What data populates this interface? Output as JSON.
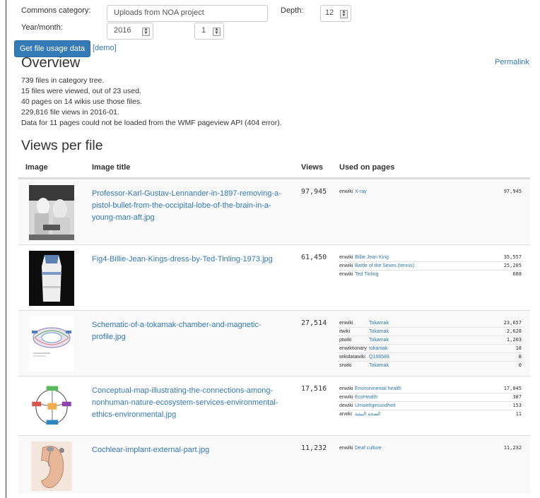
{
  "form": {
    "category_label": "Commons category:",
    "category_value": "Uploads from NOA project",
    "depth_label": "Depth:",
    "depth_value": "12",
    "yearmonth_label": "Year/month:",
    "year_value": "2016",
    "month_value": "1",
    "submit_label": "Get file usage data",
    "demo_label": "[demo]"
  },
  "overview": {
    "heading": "Overview",
    "permalink": "Permalink",
    "lines": [
      "739 files in category tree.",
      "15 files were viewed, out of 23 used.",
      "40 pages on 14 wikis use those files.",
      "229,816 file views in 2016-01.",
      "Data for 11 pages could not be loaded from the WMF pageview API (404 error)."
    ]
  },
  "views_per_file": {
    "heading": "Views per file",
    "columns": [
      "Image",
      "Image title",
      "Views",
      "Used on pages"
    ],
    "rows": [
      {
        "title": "Professor-Karl-Gustav-Lennander-in-1897-removing-a-pistol-bullet-from-the-occipital-lobe-of-the-brain-in-a-young-man-aft.jpg",
        "views": "97,945",
        "uses": [
          {
            "wiki": "enwiki",
            "page": "X-ray",
            "count": "97,945"
          }
        ]
      },
      {
        "title": "Fig4-Billie-Jean-Kings-dress-by-Ted-Tinling-1973.jpg",
        "views": "61,450",
        "uses": [
          {
            "wiki": "enwiki",
            "page": "Billie Jean King",
            "count": "35,557"
          },
          {
            "wiki": "enwiki",
            "page": "Battle of the Sexes (tennis)",
            "count": "25,205"
          },
          {
            "wiki": "enwiki",
            "page": "Ted Tinling",
            "count": "688"
          }
        ]
      },
      {
        "title": "Schematic-of-a-tokamak-chamber-and-magnetic-profile.jpg",
        "views": "27,514",
        "uses": [
          {
            "wiki": "enwiki",
            "page": "Tokamak",
            "count": "23,657"
          },
          {
            "wiki": "itwiki",
            "page": "Tokamak",
            "count": "2,628"
          },
          {
            "wiki": "ptwiki",
            "page": "Tokamak",
            "count": "1,203"
          },
          {
            "wiki": "enwiktionary",
            "page": "tokamak",
            "count": "18"
          },
          {
            "wiki": "wikidatawiki",
            "page": "Q188589",
            "count": "8"
          },
          {
            "wiki": "srwiki",
            "page": "Tokamak",
            "count": "0"
          }
        ]
      },
      {
        "title": "Conceptual-map-illustrating-the-connections-among-nonhuman-nature-ecosystem-services-environmental-ethics-environmental.jpg",
        "views": "17,516",
        "uses": [
          {
            "wiki": "enwiki",
            "page": "Environmental health",
            "count": "17,045"
          },
          {
            "wiki": "enwiki",
            "page": "EcoHealth",
            "count": "307"
          },
          {
            "wiki": "dewiki",
            "page": "Umweltgesundheit",
            "count": "153"
          },
          {
            "wiki": "arwiki",
            "page": "الصحة البيئية",
            "count": "11"
          }
        ]
      },
      {
        "title": "Cochlear-implant-external-part.jpg",
        "views": "11,232",
        "uses": [
          {
            "wiki": "enwiki",
            "page": "Deaf culture",
            "count": "11,232"
          }
        ]
      }
    ]
  },
  "colors": {
    "link": "#337ab7",
    "button": "#337ab7",
    "row_stripe": "#f9f9f9",
    "text": "#333333"
  }
}
